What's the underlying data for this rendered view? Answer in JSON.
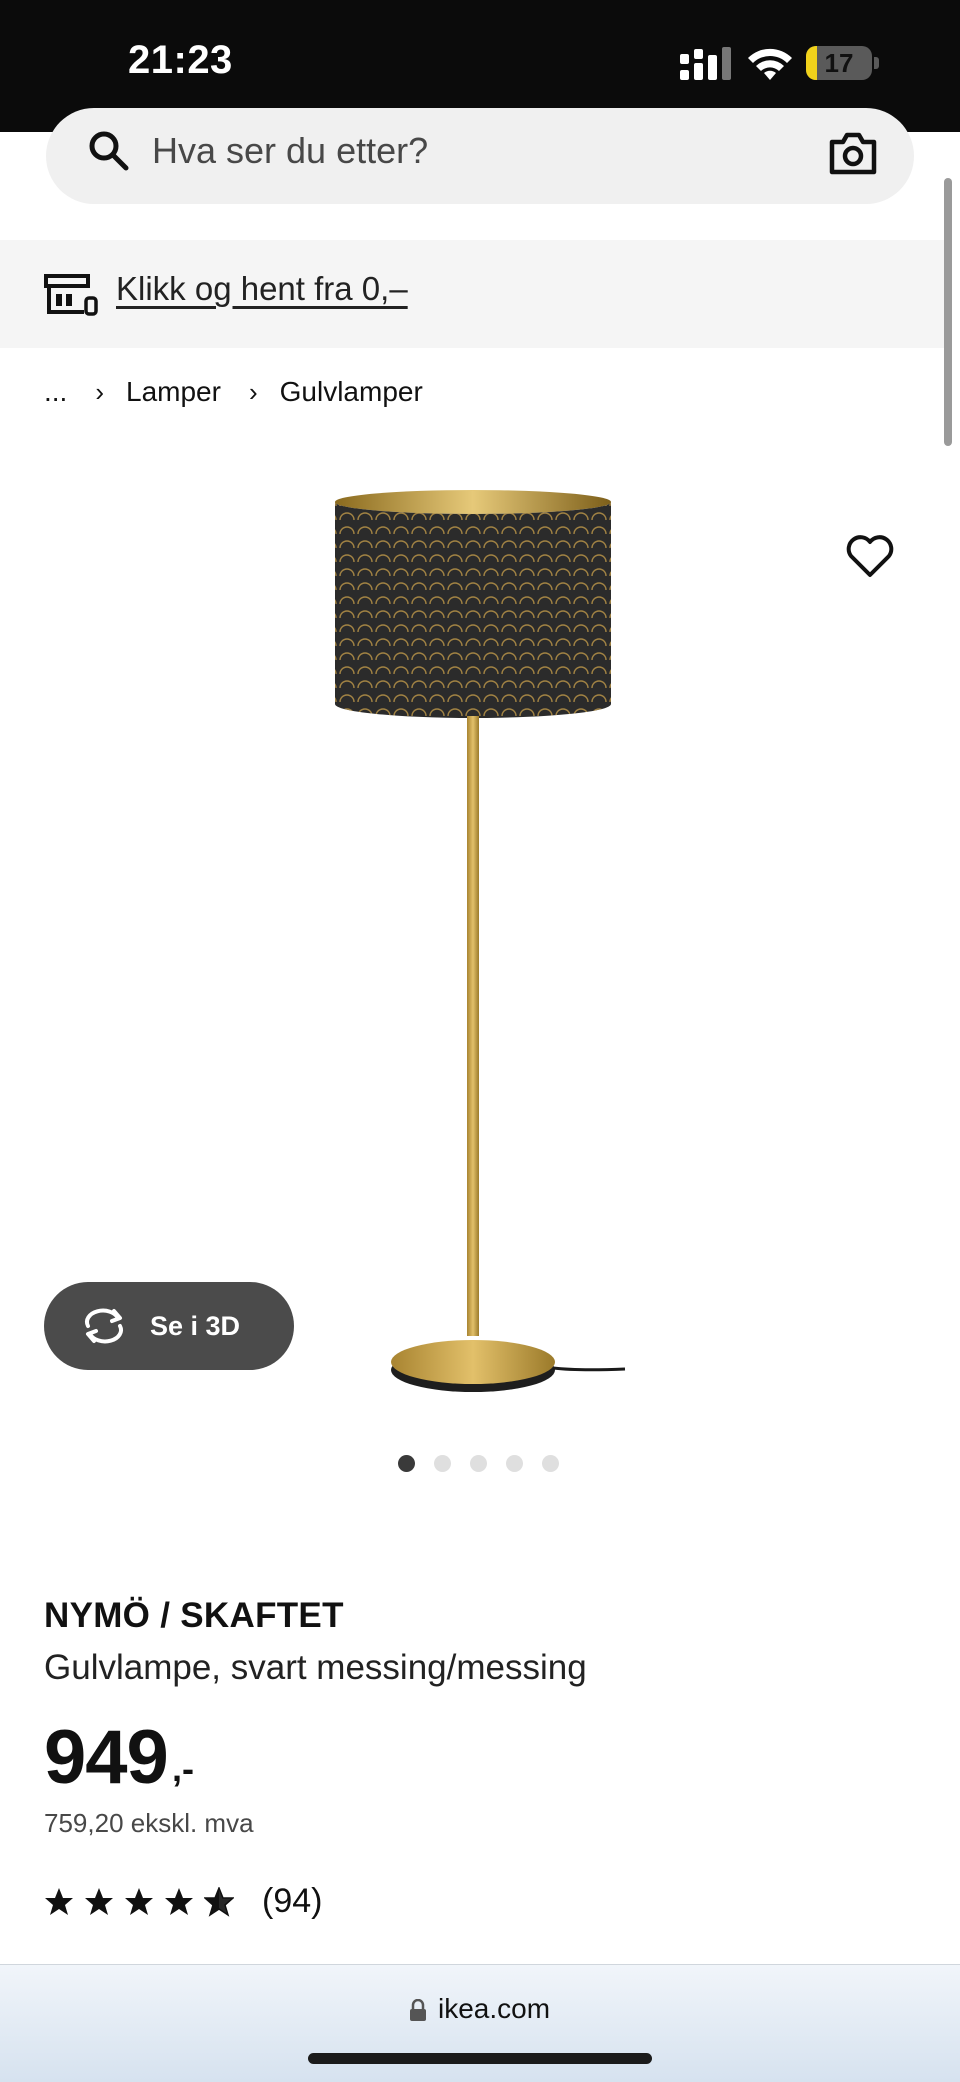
{
  "status_bar": {
    "time": "21:23",
    "battery_level": "17",
    "battery_fraction": 0.17,
    "battery_color": "#f1d21b",
    "icons": [
      "signal-icon",
      "wifi-icon",
      "battery-icon"
    ]
  },
  "search": {
    "placeholder": "Hva ser du etter?",
    "value": "",
    "icons": [
      "search-icon",
      "camera-icon"
    ]
  },
  "promo": {
    "link_text": "Klikk og hent fra 0,–",
    "icon": "store-pickup-icon"
  },
  "breadcrumb": {
    "items": [
      "...",
      "Lamper",
      "Gulvlamper"
    ]
  },
  "product": {
    "view_3d_label": "Se i 3D",
    "image_count": 5,
    "active_image_index": 0,
    "name": "NYMÖ / SKAFTET",
    "description": "Gulvlampe, svart messing/messing",
    "price": "949",
    "price_suffix": ",-",
    "price_excl_vat": "759,20 ekskl. mva",
    "rating_stars": 4.5,
    "rating_max": 5,
    "review_count": "(94)"
  },
  "browser": {
    "url": "ikea.com"
  },
  "colors": {
    "status_bar_bg": "#0b0b0b",
    "search_bg": "#f0f0f0",
    "promo_bg": "#f5f5f5",
    "button_3d_bg": "#4b4b4b",
    "brass": "#c9a54a",
    "shade_black": "#2b2b2b"
  }
}
